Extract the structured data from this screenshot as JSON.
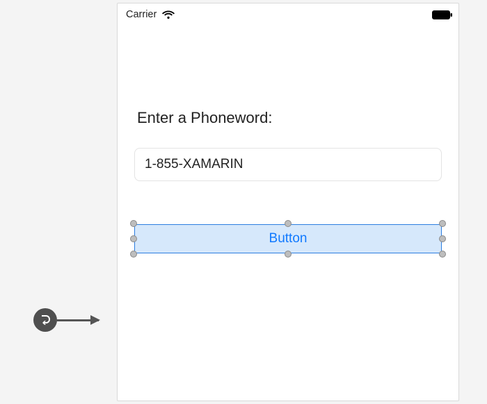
{
  "status_bar": {
    "carrier": "Carrier"
  },
  "form": {
    "prompt": "Enter a Phoneword:",
    "input_value": "1-855-XAMARIN"
  },
  "button": {
    "label": "Button"
  }
}
